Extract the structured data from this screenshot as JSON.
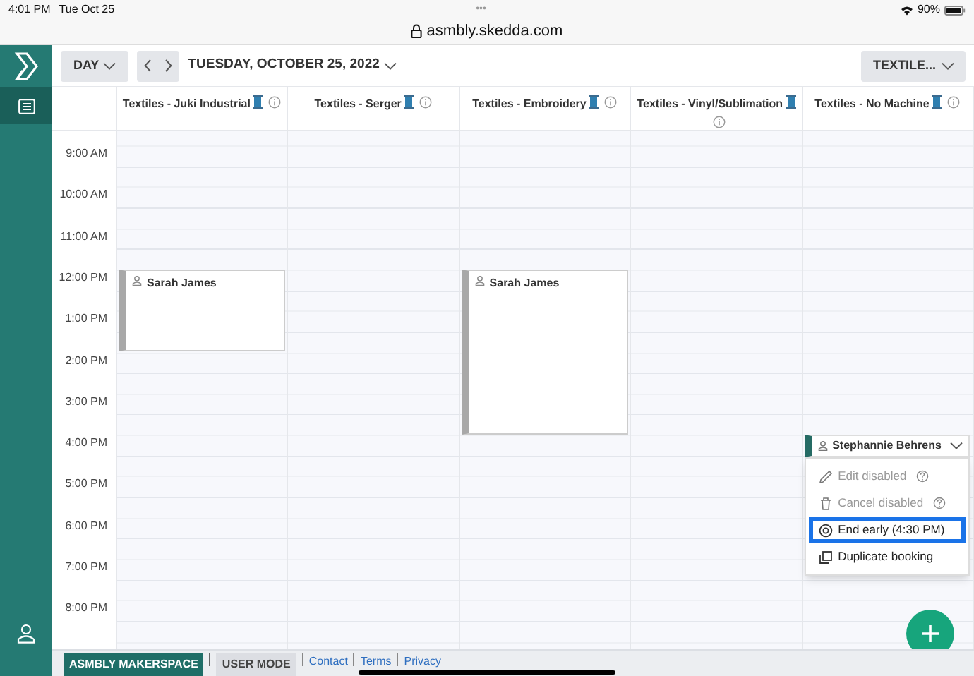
{
  "status_bar": {
    "time": "4:01 PM",
    "date": "Tue Oct 25",
    "dots": "•••",
    "battery": "90%"
  },
  "address_bar": {
    "url": "asmbly.skedda.com"
  },
  "toolbar": {
    "view": "DAY",
    "date": "TUESDAY, OCTOBER 25, 2022",
    "filter": "TEXTILE..."
  },
  "sidebar": {
    "items": [
      {
        "kind": "list",
        "selected": true
      },
      {
        "kind": "user",
        "selected": false
      }
    ]
  },
  "columns": [
    {
      "name": "Textiles - Juki Industrial",
      "bookings": [
        {
          "name": "Sarah James",
          "expanded": false
        }
      ]
    },
    {
      "name": "Textiles - Serger"
    },
    {
      "name": "Textiles - Embroidery",
      "bookings": [
        {
          "name": "Sarah James",
          "expanded": false
        }
      ]
    },
    {
      "name": "Textiles - Vinyl/Sublimation"
    },
    {
      "name": "Textiles - No Machine",
      "bookings": [
        {
          "name": "Stephannie Behrens",
          "expanded": true,
          "menu": [
            {
              "label": "Edit disabled",
              "kind": "edit",
              "disabled": true,
              "help": true,
              "highlighted": false
            },
            {
              "label": "Cancel disabled",
              "kind": "cancel",
              "disabled": true,
              "help": true,
              "highlighted": false
            },
            {
              "label": "End early (4:30 PM)",
              "kind": "end",
              "disabled": false,
              "help": false,
              "highlighted": true
            },
            {
              "label": "Duplicate booking",
              "kind": "duplicate",
              "disabled": false,
              "help": false,
              "highlighted": false
            }
          ]
        }
      ]
    }
  ],
  "times": [
    "9:00 AM",
    "10:00 AM",
    "11:00 AM",
    "12:00 PM",
    "1:00 PM",
    "2:00 PM",
    "3:00 PM",
    "4:00 PM",
    "5:00 PM",
    "6:00 PM",
    "7:00 PM",
    "8:00 PM"
  ],
  "footer": {
    "space": "ASMBLY MAKERSPACE",
    "mode": "USER MODE",
    "links": [
      "Contact",
      "Terms",
      "Privacy"
    ]
  }
}
